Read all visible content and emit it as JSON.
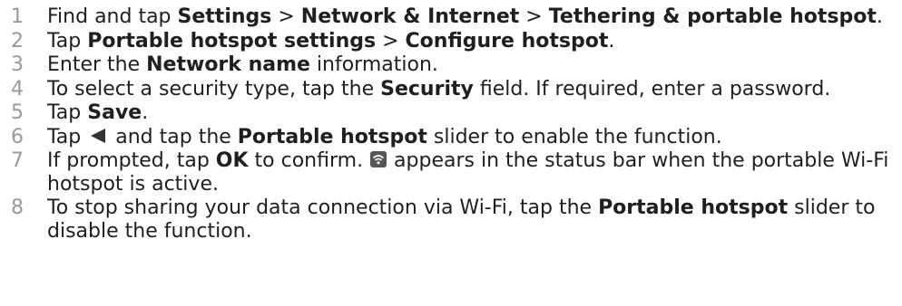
{
  "steps": [
    {
      "num": "1",
      "parts": [
        {
          "t": "Find and tap ",
          "b": false
        },
        {
          "t": "Settings",
          "b": true
        },
        {
          "t": " > ",
          "b": false
        },
        {
          "t": "Network & Internet",
          "b": true
        },
        {
          "t": " > ",
          "b": false
        },
        {
          "t": "Tethering & portable hotspot",
          "b": true
        },
        {
          "t": ".",
          "b": false
        }
      ]
    },
    {
      "num": "2",
      "parts": [
        {
          "t": "Tap ",
          "b": false
        },
        {
          "t": "Portable hotspot settings",
          "b": true
        },
        {
          "t": " > ",
          "b": false
        },
        {
          "t": "Configure hotspot",
          "b": true
        },
        {
          "t": ".",
          "b": false
        }
      ]
    },
    {
      "num": "3",
      "parts": [
        {
          "t": "Enter the ",
          "b": false
        },
        {
          "t": "Network name",
          "b": true
        },
        {
          "t": " information.",
          "b": false
        }
      ]
    },
    {
      "num": "4",
      "parts": [
        {
          "t": "To select a security type, tap the ",
          "b": false
        },
        {
          "t": "Security",
          "b": true
        },
        {
          "t": " field. If required, enter a password.",
          "b": false
        }
      ]
    },
    {
      "num": "5",
      "parts": [
        {
          "t": "Tap ",
          "b": false
        },
        {
          "t": "Save",
          "b": true
        },
        {
          "t": ".",
          "b": false
        }
      ]
    },
    {
      "num": "6",
      "parts": [
        {
          "t": "Tap ",
          "b": false
        },
        {
          "icon": "back-icon"
        },
        {
          "t": " and tap the ",
          "b": false
        },
        {
          "t": "Portable hotspot",
          "b": true
        },
        {
          "t": " slider to enable the function.",
          "b": false
        }
      ]
    },
    {
      "num": "7",
      "parts": [
        {
          "t": "If prompted, tap ",
          "b": false
        },
        {
          "t": "OK",
          "b": true
        },
        {
          "t": " to confirm. ",
          "b": false
        },
        {
          "icon": "wifi-hotspot-icon"
        },
        {
          "t": " appears in the status bar when the portable Wi-Fi hotspot is active.",
          "b": false
        }
      ]
    },
    {
      "num": "8",
      "parts": [
        {
          "t": "To stop sharing your data connection via Wi-Fi, tap the ",
          "b": false
        },
        {
          "t": "Portable hotspot",
          "b": true
        },
        {
          "t": " slider to disable the function.",
          "b": false
        }
      ]
    }
  ],
  "colors": {
    "text": "#1f1f1f",
    "step_number": "#9a9a9a",
    "icon": "#333333"
  }
}
